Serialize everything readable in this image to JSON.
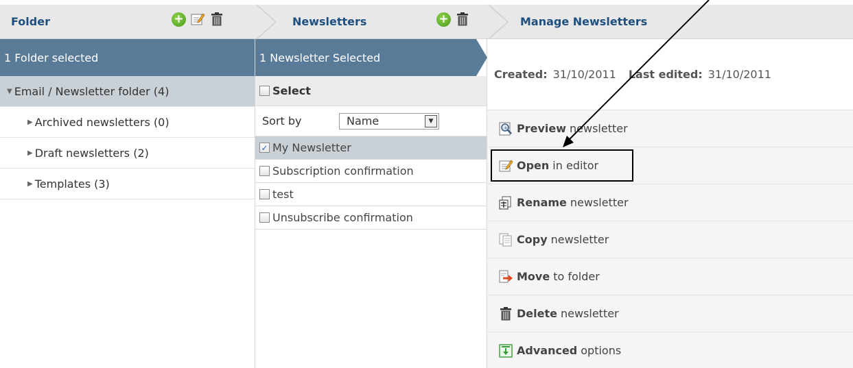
{
  "folder_panel": {
    "title": "Folder",
    "selected_label": "1 Folder selected",
    "folders": [
      {
        "label": "Email / Newsletter folder (4)",
        "expanded": true,
        "active": true,
        "indent": 0
      },
      {
        "label": "Archived newsletters (0)",
        "expanded": false,
        "active": false,
        "indent": 1
      },
      {
        "label": "Draft newsletters (2)",
        "expanded": false,
        "active": false,
        "indent": 1
      },
      {
        "label": "Templates (3)",
        "expanded": false,
        "active": false,
        "indent": 1
      }
    ]
  },
  "newsletters_panel": {
    "title": "Newsletters",
    "selected_label": "1 Newsletter Selected",
    "select_label": "Select",
    "sort_label": "Sort by",
    "sort_value": "Name",
    "items": [
      {
        "label": "My Newsletter",
        "checked": true
      },
      {
        "label": "Subscription confirmation",
        "checked": false
      },
      {
        "label": "test",
        "checked": false
      },
      {
        "label": "Unsubscribe confirmation",
        "checked": false
      }
    ]
  },
  "manage_panel": {
    "title": "Manage Newsletters",
    "created_label": "Created:",
    "created_value": "31/10/2011",
    "edited_label": "Last edited:",
    "edited_value": "31/10/2011",
    "actions": [
      {
        "bold": "Preview",
        "rest": "newsletter",
        "icon": "preview-icon"
      },
      {
        "bold": "Open",
        "rest": "in editor",
        "icon": "edit-icon"
      },
      {
        "bold": "Rename",
        "rest": "newsletter",
        "icon": "rename-icon"
      },
      {
        "bold": "Copy",
        "rest": "newsletter",
        "icon": "copy-icon"
      },
      {
        "bold": "Move",
        "rest": "to folder",
        "icon": "move-icon"
      },
      {
        "bold": "Delete",
        "rest": "newsletter",
        "icon": "trash-icon"
      },
      {
        "bold": "Advanced",
        "rest": "options",
        "icon": "advanced-icon"
      }
    ]
  },
  "colors": {
    "selected_bar": "#5a7b98",
    "active_row": "#c9d0d6",
    "header_title": "#1f4f7f",
    "add_green": "#5cb82a"
  }
}
